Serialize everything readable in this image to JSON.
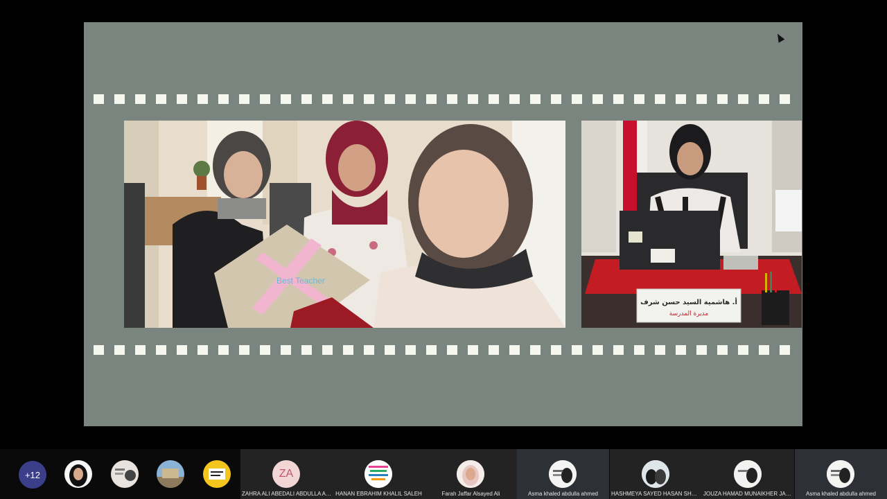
{
  "participants_overflow": "+12",
  "placard_name": "أ. هاشمية السيد حسن شرف",
  "placard_title": "مديرة المدرسة",
  "gift_text": "Best Teacher",
  "tiles": [
    {
      "initials": "ZA",
      "name": "ZAHRA ALI ABEDALI ABDULLA ABE..."
    },
    {
      "initials": "",
      "name": "HANAN EBRAHIM KHALIL SALEH"
    },
    {
      "initials": "",
      "name": "Farah Jaffar Alsayed Ali"
    },
    {
      "initials": "",
      "name": "Asma khaled abdulla ahmed"
    },
    {
      "initials": "",
      "name": "HASHMEYA SAYED HASAN SHARAF"
    },
    {
      "initials": "",
      "name": "JOUZA HAMAD MUNAIKHER JABER"
    },
    {
      "initials": "",
      "name": "Asma khaled abdulla ahmed"
    }
  ],
  "colors": {
    "stage": "#7b8580",
    "film_hole": "#f5f7ee",
    "overflow_badge": "#3b3f8a",
    "tile_bg": "#232323"
  }
}
